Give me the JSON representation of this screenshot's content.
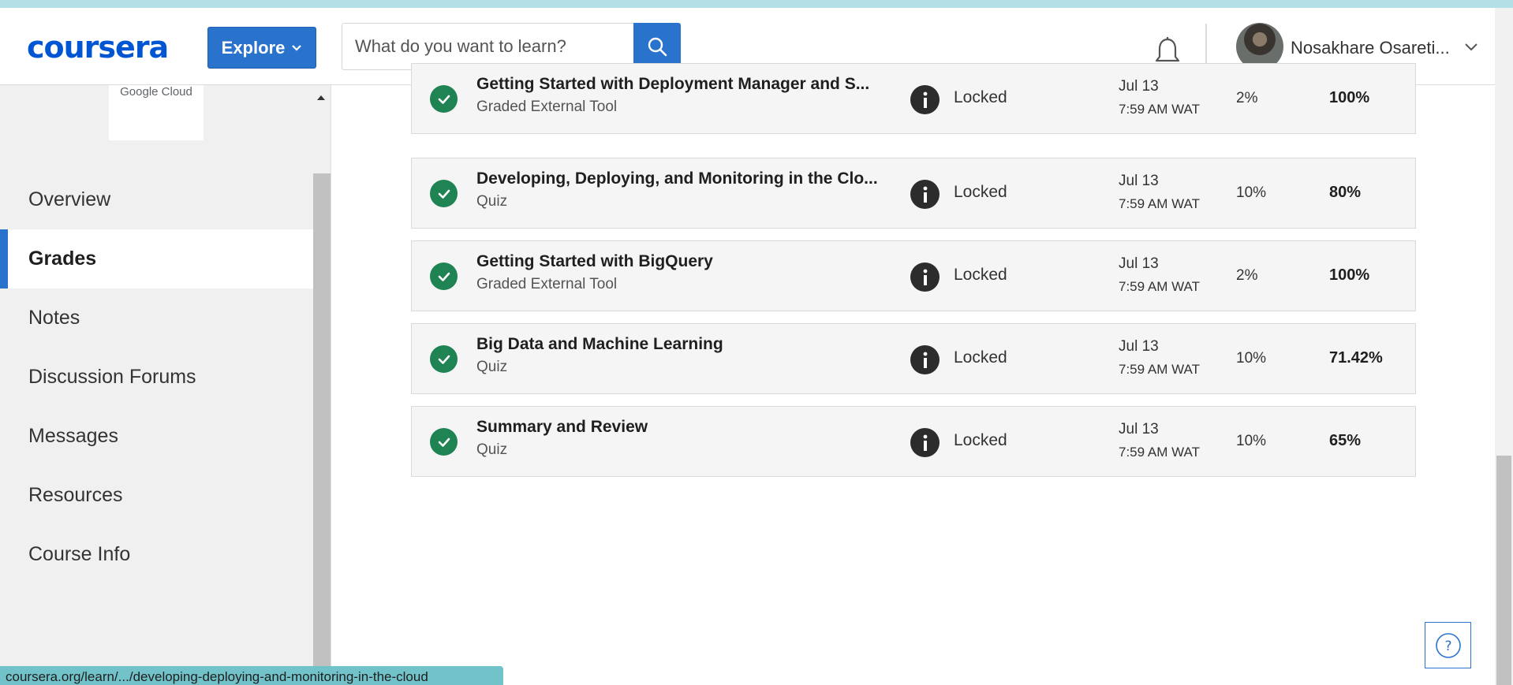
{
  "header": {
    "logo_text": "coursera",
    "explore_label": "Explore",
    "search_placeholder": "What do you want to learn?",
    "user_name": "Nosakhare Osareti..."
  },
  "sidebar": {
    "partner_logo_text": "Google Cloud",
    "items": [
      {
        "label": "Overview",
        "active": false
      },
      {
        "label": "Grades",
        "active": true
      },
      {
        "label": "Notes",
        "active": false
      },
      {
        "label": "Discussion Forums",
        "active": false
      },
      {
        "label": "Messages",
        "active": false
      },
      {
        "label": "Resources",
        "active": false
      },
      {
        "label": "Course Info",
        "active": false
      }
    ]
  },
  "grades": [
    {
      "title": "Getting Started with Deployment Manager and S...",
      "type": "Graded External Tool",
      "status": "Locked",
      "due_date": "Jul 13",
      "due_time": "7:59 AM WAT",
      "weight": "2%",
      "grade": "100%"
    },
    {
      "title": "Developing, Deploying, and Monitoring in the Clo...",
      "type": "Quiz",
      "status": "Locked",
      "due_date": "Jul 13",
      "due_time": "7:59 AM WAT",
      "weight": "10%",
      "grade": "80%"
    },
    {
      "title": "Getting Started with BigQuery",
      "type": "Graded External Tool",
      "status": "Locked",
      "due_date": "Jul 13",
      "due_time": "7:59 AM WAT",
      "weight": "2%",
      "grade": "100%"
    },
    {
      "title": "Big Data and Machine Learning",
      "type": "Quiz",
      "status": "Locked",
      "due_date": "Jul 13",
      "due_time": "7:59 AM WAT",
      "weight": "10%",
      "grade": "71.42%"
    },
    {
      "title": "Summary and Review",
      "type": "Quiz",
      "status": "Locked",
      "due_date": "Jul 13",
      "due_time": "7:59 AM WAT",
      "weight": "10%",
      "grade": "65%"
    }
  ],
  "status_bar_url": "coursera.org/learn/.../developing-deploying-and-monitoring-in-the-cloud",
  "colors": {
    "brand": "#0056d2",
    "button": "#2a73cc",
    "check": "#1f8354",
    "status_bar": "#72c2c9"
  },
  "icons": [
    "search-icon",
    "bell-icon",
    "chevron-down-icon",
    "check-circle-icon",
    "info-icon",
    "help-icon"
  ]
}
